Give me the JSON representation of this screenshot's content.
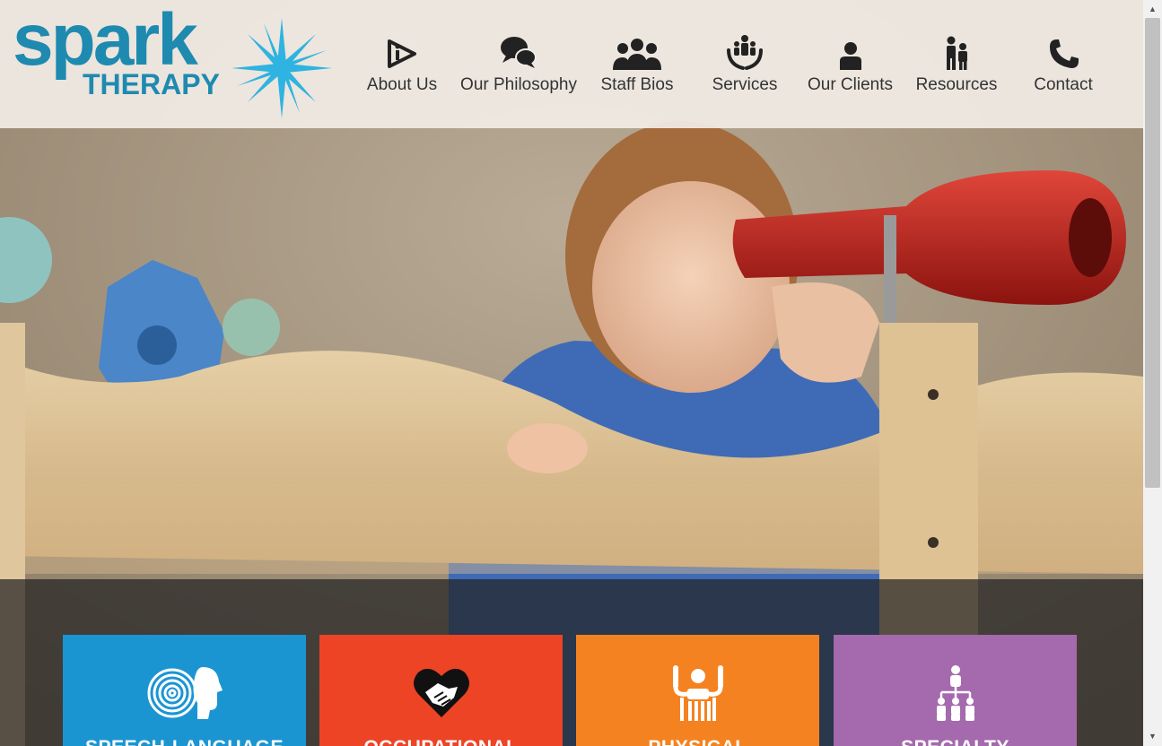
{
  "logo": {
    "word1": "spark",
    "word2": "THERAPY"
  },
  "nav": [
    {
      "label": "About Us",
      "icon": "info-icon"
    },
    {
      "label": "Our Philosophy",
      "icon": "chat-bubbles-icon"
    },
    {
      "label": "Staff Bios",
      "icon": "people-group-icon"
    },
    {
      "label": "Services",
      "icon": "hands-family-icon"
    },
    {
      "label": "Our Clients",
      "icon": "person-icon"
    },
    {
      "label": "Resources",
      "icon": "parent-child-icon"
    },
    {
      "label": "Contact",
      "icon": "phone-icon"
    }
  ],
  "services": [
    {
      "title": "SPEECH-LANGUAGE",
      "color": "#1b95d2",
      "icon": "speech-spiral-head-icon"
    },
    {
      "title": "OCCUPATIONAL",
      "color": "#ed4426",
      "icon": "heart-handshake-icon"
    },
    {
      "title": "PHYSICAL",
      "color": "#f58220",
      "icon": "raised-arms-person-icon"
    },
    {
      "title": "SPECIALTY",
      "color": "#a569ad",
      "icon": "hierarchy-people-icon"
    }
  ],
  "colors": {
    "brand": "#1e8ab0",
    "star": "#2fb3e0",
    "header_bg": "#f1ece5"
  }
}
